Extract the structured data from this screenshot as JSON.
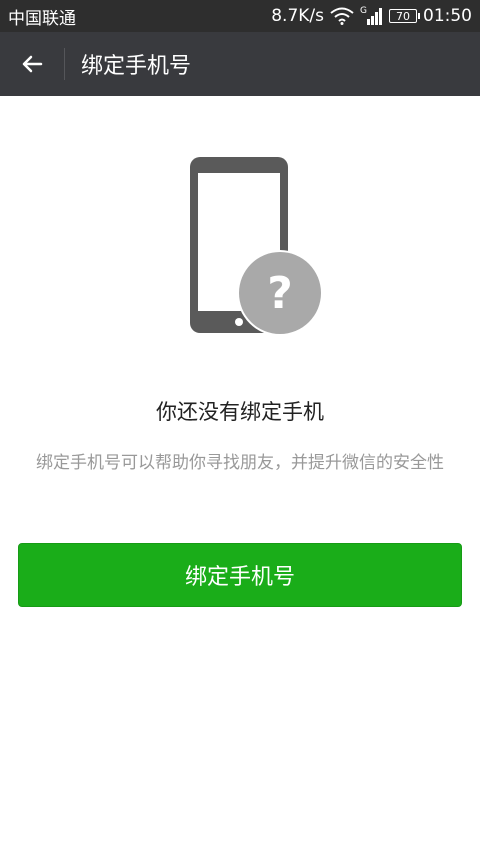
{
  "status_bar": {
    "carrier": "中国联通",
    "network_speed": "8.7K/s",
    "signal_type": "G",
    "battery_level": "70",
    "time": "01:50"
  },
  "title_bar": {
    "title": "绑定手机号"
  },
  "content": {
    "headline": "你还没有绑定手机",
    "description": "绑定手机号可以帮助你寻找朋友，并提升微信的安全性"
  },
  "action": {
    "button_label": "绑定手机号",
    "button_color": "#1aad19"
  },
  "icons": {
    "back": "back-arrow-icon",
    "phone": "phone-icon",
    "question": "question-mark-icon",
    "wifi": "wifi-icon",
    "signal": "signal-bars-icon",
    "battery": "battery-icon"
  }
}
